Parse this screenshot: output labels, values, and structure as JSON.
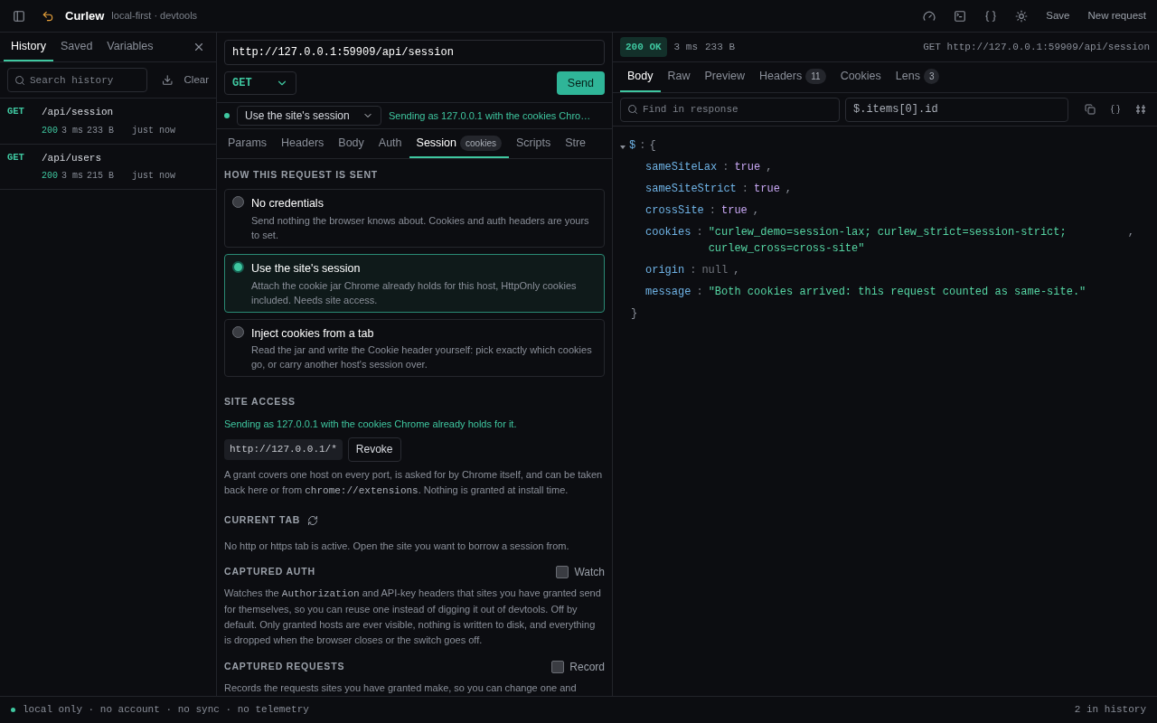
{
  "app": {
    "name": "Curlew",
    "subtitle": "local-first · devtools",
    "actions": [
      "Save",
      "New request"
    ]
  },
  "sidebar": {
    "tabs": [
      {
        "label": "History",
        "selected": true
      },
      {
        "label": "Saved",
        "selected": false
      },
      {
        "label": "Variables",
        "selected": false
      }
    ],
    "search": {
      "placeholder": "Search history"
    },
    "clear": "Clear",
    "history": [
      {
        "method": "GET",
        "path": "/api/session",
        "status": "200",
        "time": "3 ms",
        "size": "233 B",
        "when": "just now"
      },
      {
        "method": "GET",
        "path": "/api/users",
        "status": "200",
        "time": "3 ms",
        "size": "215 B",
        "when": "just now"
      }
    ]
  },
  "request": {
    "url": "http://127.0.0.1:59909/api/session",
    "method": "GET",
    "send": "Send",
    "session_mode": "Use the site's session",
    "session_note": "Sending as 127.0.0.1 with the cookies Chro…",
    "tabs": [
      {
        "label": "Params",
        "selected": false
      },
      {
        "label": "Headers",
        "selected": false
      },
      {
        "label": "Body",
        "selected": false
      },
      {
        "label": "Auth",
        "selected": false
      },
      {
        "label": "Session",
        "badge": "cookies",
        "selected": true
      },
      {
        "label": "Scripts",
        "selected": false
      },
      {
        "label": "Stre",
        "selected": false
      }
    ],
    "how_heading": "HOW THIS REQUEST IS SENT",
    "options": [
      {
        "title": "No credentials",
        "text": "Send nothing the browser knows about. Cookies and auth headers are yours to set.",
        "selected": false
      },
      {
        "title": "Use the site's session",
        "text": "Attach the cookie jar Chrome already holds for this host, HttpOnly cookies included. Needs site access.",
        "selected": true
      },
      {
        "title": "Inject cookies from a tab",
        "text": "Read the jar and write the Cookie header yourself: pick exactly which cookies go, or carry another host's session over.",
        "selected": false
      }
    ],
    "site_access": {
      "heading": "SITE ACCESS",
      "status": "Sending as 127.0.0.1 with the cookies Chrome already holds for it.",
      "grant": "http://127.0.0.1/*",
      "revoke": "Revoke",
      "note": [
        {
          "kind": "text",
          "text": "A grant covers one host on every port, is asked for by Chrome itself, and can be taken back here or from "
        },
        {
          "kind": "code",
          "text": "chrome://extensions"
        },
        {
          "kind": "text",
          "text": ". Nothing is granted at install time."
        }
      ]
    },
    "current_tab": {
      "heading": "CURRENT TAB",
      "text": "No http or https tab is active. Open the site you want to borrow a session from."
    },
    "captured_auth": {
      "heading": "CAPTURED AUTH",
      "toggle": "Watch",
      "checked": false,
      "text": [
        {
          "kind": "text",
          "text": "Watches the "
        },
        {
          "kind": "code",
          "text": "Authorization"
        },
        {
          "kind": "text",
          "text": " and API-key headers that sites you have granted send for themselves, so you can reuse one instead of digging it out of devtools. Off by default. Only granted hosts are ever visible, nothing is written to disk, and everything is dropped when the browser closes or the switch goes off."
        }
      ]
    },
    "captured_requests": {
      "heading": "CAPTURED REQUESTS",
      "toggle": "Record",
      "checked": false,
      "text": [
        {
          "kind": "text",
          "text": "Records the requests sites you have granted make, so you can change one and"
        }
      ]
    }
  },
  "response": {
    "status": "200 OK",
    "time": "3 ms",
    "size": "233 B",
    "request_line": "GET http://127.0.0.1:59909/api/session",
    "tabs": [
      {
        "label": "Body",
        "selected": true
      },
      {
        "label": "Raw",
        "selected": false
      },
      {
        "label": "Preview",
        "selected": false
      },
      {
        "label": "Headers",
        "count": "11",
        "selected": false
      },
      {
        "label": "Cookies",
        "selected": false
      },
      {
        "label": "Lens",
        "count": "3",
        "selected": false
      }
    ],
    "find": {
      "placeholder": "Find in response"
    },
    "path_query": "$.items[0].id",
    "root": "$",
    "root_colon": ":",
    "expanded": true,
    "open": "{",
    "close": "}",
    "fields": [
      {
        "key": "sameSiteLax",
        "colon": ":",
        "kind": "bool",
        "value": "true",
        "comma": ","
      },
      {
        "key": "sameSiteStrict",
        "colon": ":",
        "kind": "bool",
        "value": "true",
        "comma": ","
      },
      {
        "key": "crossSite",
        "colon": ":",
        "kind": "bool",
        "value": "true",
        "comma": ","
      },
      {
        "key": "cookies",
        "colon": ":",
        "kind": "string",
        "value": "\"curlew_demo=session-lax; curlew_strict=session-strict; curlew_cross=cross-site\"",
        "comma": ","
      },
      {
        "key": "origin",
        "colon": ":",
        "kind": "null",
        "value": "null",
        "comma": ","
      },
      {
        "key": "message",
        "colon": ":",
        "kind": "string",
        "value": "\"Both cookies arrived: this request counted as same-site.\""
      }
    ]
  },
  "status_bar": {
    "left": "local only · no account · no sync · no telemetry",
    "right": "2 in history"
  }
}
